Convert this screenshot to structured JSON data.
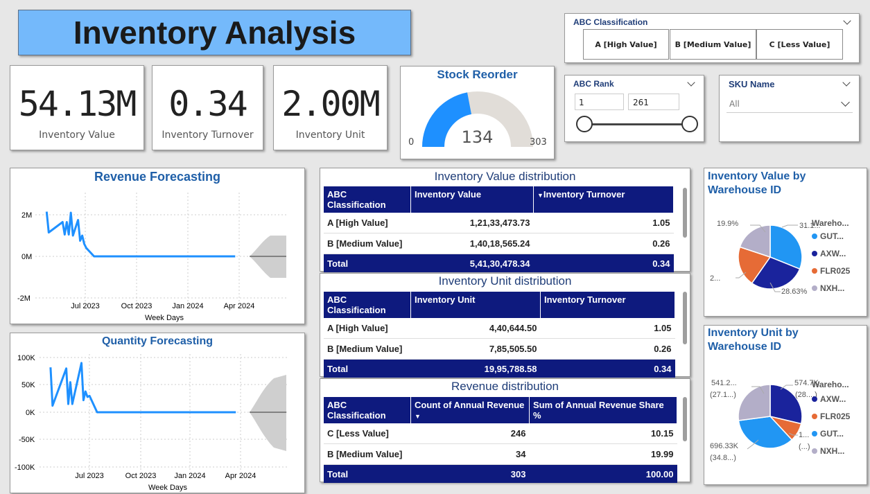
{
  "page_title": "Inventory Analysis",
  "kpis": [
    {
      "value": "54.13M",
      "label": "Inventory Value"
    },
    {
      "value": "0.34",
      "label": "Inventory Turnover"
    },
    {
      "value": "2.00M",
      "label": "Inventory Unit"
    }
  ],
  "stock_reorder": {
    "title": "Stock Reorder",
    "value": "134",
    "min": "0",
    "max": "303",
    "fill_fraction": 0.44,
    "fill_color": "#1e90ff",
    "track_color": "#e1ddd8"
  },
  "abc_slicer": {
    "title": "ABC Classification",
    "options": [
      "A [High Value]",
      "B [Medium Value]",
      "C [Less Value]"
    ]
  },
  "abc_rank": {
    "title": "ABC Rank",
    "min": "1",
    "max": "261"
  },
  "sku_slicer": {
    "title": "SKU Name",
    "selected": "All"
  },
  "revenue_forecast": {
    "title": "Revenue Forecasting",
    "xlabel": "Week Days",
    "yticks": [
      "2M",
      "0M",
      "-2M"
    ],
    "xticks": [
      "Jul 2023",
      "Oct 2023",
      "Jan 2024",
      "Apr 2024"
    ]
  },
  "quantity_forecast": {
    "title": "Quantity Forecasting",
    "xlabel": "Week Days",
    "yticks": [
      "100K",
      "50K",
      "0K",
      "-50K",
      "-100K"
    ],
    "xticks": [
      "Jul 2023",
      "Oct 2023",
      "Jan 2024",
      "Apr 2024"
    ]
  },
  "value_table": {
    "title": "Inventory Value distribution",
    "headers": [
      "ABC Classification",
      "Inventory Value",
      "Inventory Turnover"
    ],
    "rows": [
      [
        "A [High Value]",
        "1,21,33,473.73",
        "1.05"
      ],
      [
        "B [Medium Value]",
        "1,40,18,565.24",
        "0.26"
      ]
    ],
    "total": [
      "Total",
      "5,41,30,478.34",
      "0.34"
    ]
  },
  "unit_table": {
    "title": "Inventory Unit distribution",
    "headers": [
      "ABC Classification",
      "Inventory Unit",
      "Inventory Turnover"
    ],
    "rows": [
      [
        "A [High Value]",
        "4,40,644.50",
        "1.05"
      ],
      [
        "B [Medium Value]",
        "7,85,505.50",
        "0.26"
      ]
    ],
    "total": [
      "Total",
      "19,95,788.58",
      "0.34"
    ]
  },
  "revenue_table": {
    "title": "Revenue distribution",
    "headers": [
      "ABC Classification",
      "Count of Annual Revenue",
      "Sum of Annual Revenue Share %"
    ],
    "rows": [
      [
        "C [Less Value]",
        "246",
        "10.15"
      ],
      [
        "B [Medium Value]",
        "34",
        "19.99"
      ]
    ],
    "total": [
      "Total",
      "303",
      "100.00"
    ]
  },
  "value_pie": {
    "title": "Inventory Value by Warehouse ID",
    "legend_title": "Wareho...",
    "legend": [
      {
        "name": "GUT...",
        "color": "#2196f3"
      },
      {
        "name": "AXW...",
        "color": "#1a239c"
      },
      {
        "name": "FLR025",
        "color": "#e66b36"
      },
      {
        "name": "NXH...",
        "color": "#b3aec8"
      }
    ],
    "labels": [
      "19.9%",
      "31.1...",
      "2...",
      "28.63%"
    ]
  },
  "unit_pie": {
    "title": "Inventory Unit by Warehouse ID",
    "legend_title": "Wareho...",
    "legend": [
      {
        "name": "AXW...",
        "color": "#1a239c"
      },
      {
        "name": "FLR025",
        "color": "#e66b36"
      },
      {
        "name": "GUT...",
        "color": "#2196f3"
      },
      {
        "name": "NXH...",
        "color": "#b3aec8"
      }
    ],
    "labels": [
      "541.2...",
      "(27.1...)",
      "574.7K",
      "(28....)",
      "1...",
      "(...)",
      "696.33K",
      "(34.8...)"
    ]
  },
  "chart_data": [
    {
      "type": "line",
      "title": "Revenue Forecasting",
      "xlabel": "Week Days",
      "ylabel": "",
      "ylim": [
        -2000000,
        2000000
      ],
      "x": [
        "2023-05",
        "2023-05",
        "2023-06",
        "2023-06",
        "2023-06",
        "2023-06",
        "2023-06",
        "2023-06",
        "2023-07",
        "2023-07",
        "2023-07",
        "2023-07",
        "2023-07",
        "2023-08",
        "2023-08",
        "2024-05"
      ],
      "series": [
        {
          "values": [
            2150000,
            1150000,
            1650000,
            1050000,
            1650000,
            1050000,
            2100000,
            1000000,
            1750000,
            750000,
            1000000,
            600000,
            400000,
            0,
            0,
            0
          ]
        }
      ]
    },
    {
      "type": "line",
      "title": "Quantity Forecasting",
      "xlabel": "Week Days",
      "ylabel": "",
      "ylim": [
        -100000,
        100000
      ],
      "x": [
        "2023-05",
        "2023-05",
        "2023-06",
        "2023-06",
        "2023-06",
        "2023-06",
        "2023-07",
        "2023-07",
        "2023-07",
        "2023-07",
        "2023-07",
        "2023-08",
        "2023-08",
        "2024-05"
      ],
      "series": [
        {
          "values": [
            82000,
            12000,
            80000,
            15000,
            55000,
            15000,
            90000,
            22000,
            38000,
            28000,
            30000,
            0,
            0,
            0
          ]
        }
      ]
    },
    {
      "type": "pie",
      "title": "Inventory Value by Warehouse ID",
      "categories": [
        "GUT...",
        "AXW...",
        "FLR025",
        "NXH..."
      ],
      "values": [
        31.1,
        28.63,
        20.4,
        19.9
      ]
    },
    {
      "type": "pie",
      "title": "Inventory Unit by Warehouse ID",
      "categories": [
        "AXW...",
        "FLR025",
        "GUT...",
        "NXH..."
      ],
      "values": [
        28.7,
        9.4,
        34.8,
        27.1
      ]
    }
  ]
}
